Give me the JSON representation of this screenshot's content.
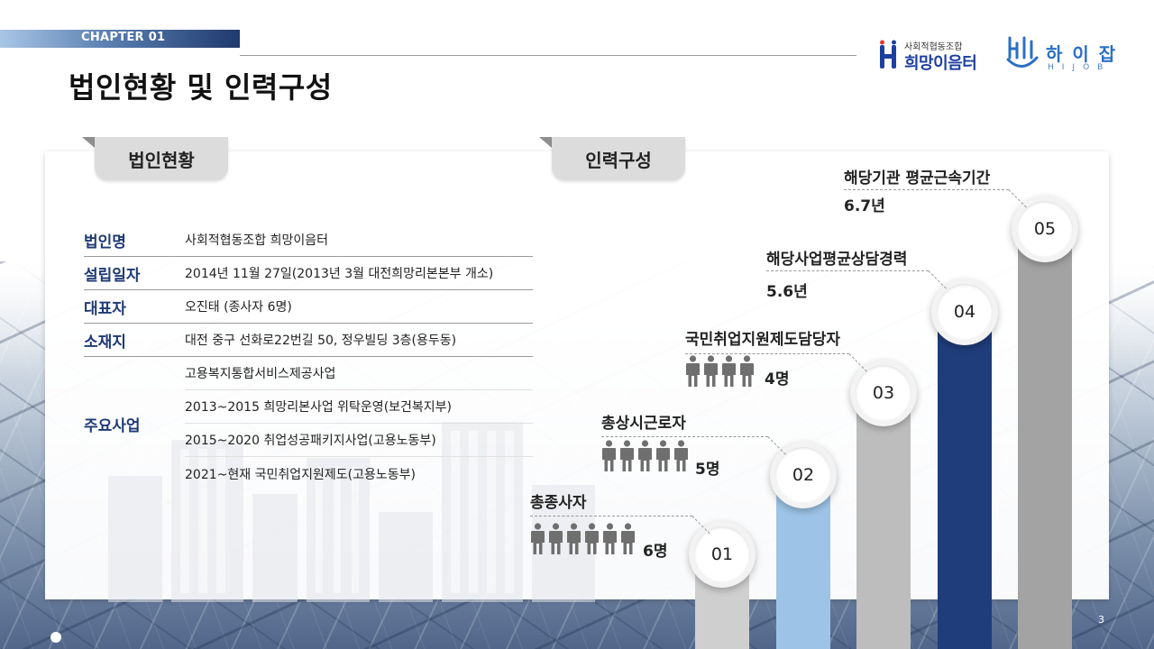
{
  "header": {
    "chapter": "CHAPTER 01",
    "title": "법인현황 및 인력구성"
  },
  "logos": {
    "hope_sub": "사회적협동조합",
    "hope_main": "희망이음터",
    "hijob_main": "하 이 잡",
    "hijob_sub": "HIJOB"
  },
  "tabs": {
    "corporation": "법인현황",
    "workforce": "인력구성"
  },
  "corporation": {
    "rows": [
      {
        "label": "법인명",
        "value": "사회적협동조합 희망이음터"
      },
      {
        "label": "설립일자",
        "value": "2014년 11월 27일(2013년 3월 대전희망리본본부 개소)"
      },
      {
        "label": "대표자",
        "value": "오진태 (종사자 6명)"
      },
      {
        "label": "소재지",
        "value": "대전 중구 선화로22번길 50, 정우빌딩 3층(용두동)"
      }
    ],
    "business_label": "주요사업",
    "business_items": [
      "고용복지통합서비스제공사업",
      "2013~2015 희망리본사업 위탁운영(보건복지부)",
      "2015~2020 취업성공패키지사업(고용노동부)",
      "2021~현재 국민취업지원제도(고용노동부)"
    ]
  },
  "workforce": {
    "steps": [
      {
        "number": "01",
        "label": "총종사자",
        "value": "6명",
        "people": 6
      },
      {
        "number": "02",
        "label": "총상시근로자",
        "value": "5명",
        "people": 5
      },
      {
        "number": "03",
        "label": "국민취업지원제도담당자",
        "value": "4명",
        "people": 4
      },
      {
        "number": "04",
        "label": "해당사업평균상담경력",
        "value": "5.6년",
        "people": 0
      },
      {
        "number": "05",
        "label": "해당기관 평균근속기간",
        "value": "6.7년",
        "people": 0
      }
    ]
  },
  "footer": {
    "page": "3"
  },
  "colors": {
    "navy": "#1f3d7a",
    "label_blue": "#1e3a75",
    "light_blue": "#9dc3e6",
    "gray": "#bdbdbd"
  }
}
